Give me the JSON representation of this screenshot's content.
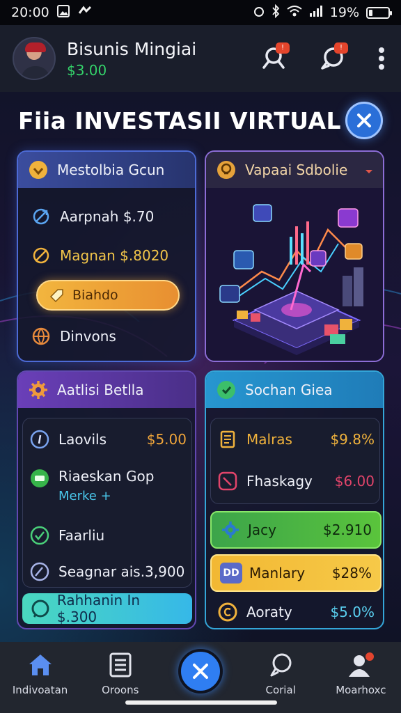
{
  "status_bar": {
    "time": "20:00",
    "battery": "19%",
    "battery_level": 0.19
  },
  "header": {
    "name": "Bisunis Mingiai",
    "balance": "$3.00",
    "search_badge": "!",
    "chat_badge": "!"
  },
  "screen": {
    "title": "Fiia INVESTASII VIRTUAL"
  },
  "panel_left_top": {
    "title": "Mestolbia Gcun",
    "rows": [
      {
        "label": "Aarpnah $.70"
      },
      {
        "label": "Magnan $.8020"
      }
    ],
    "button": "Biahdo",
    "footer": "Dinvons"
  },
  "panel_right_top": {
    "title": "Vapaai Sdbolie"
  },
  "panel_left_bottom": {
    "title": "Aatlisi Betlla",
    "rows": [
      {
        "label": "Laovils",
        "value": "$5.00"
      },
      {
        "label": "Riaeskan Gop",
        "sub": "Merke +"
      },
      {
        "label": "Faarliu"
      },
      {
        "label": "Seagnar ais.3,900"
      }
    ],
    "cta": "Rahhanin In $.300"
  },
  "panel_right_bottom": {
    "title": "Sochan Giea",
    "rows": [
      {
        "label": "Malras",
        "value": "$9.8%"
      },
      {
        "label": "Fhaskagy",
        "value": "$6.00"
      },
      {
        "label": "Jacy",
        "value": "$2.910"
      },
      {
        "label": "Manlary",
        "value": "$28%",
        "badge": "DD"
      },
      {
        "label": "Aoraty",
        "value": "$5.0%"
      }
    ]
  },
  "nav": {
    "items": [
      {
        "label": "Indivoatan"
      },
      {
        "label": "Oroons"
      },
      {
        "label": "Corial"
      },
      {
        "label": "Moarhoxc"
      }
    ]
  },
  "colors": {
    "accent_blue": "#2f7ef2",
    "balance_green": "#34d26a",
    "gold": "#f0b23c",
    "green_row": "#3cae3c",
    "yellow_row": "#f2b833"
  }
}
